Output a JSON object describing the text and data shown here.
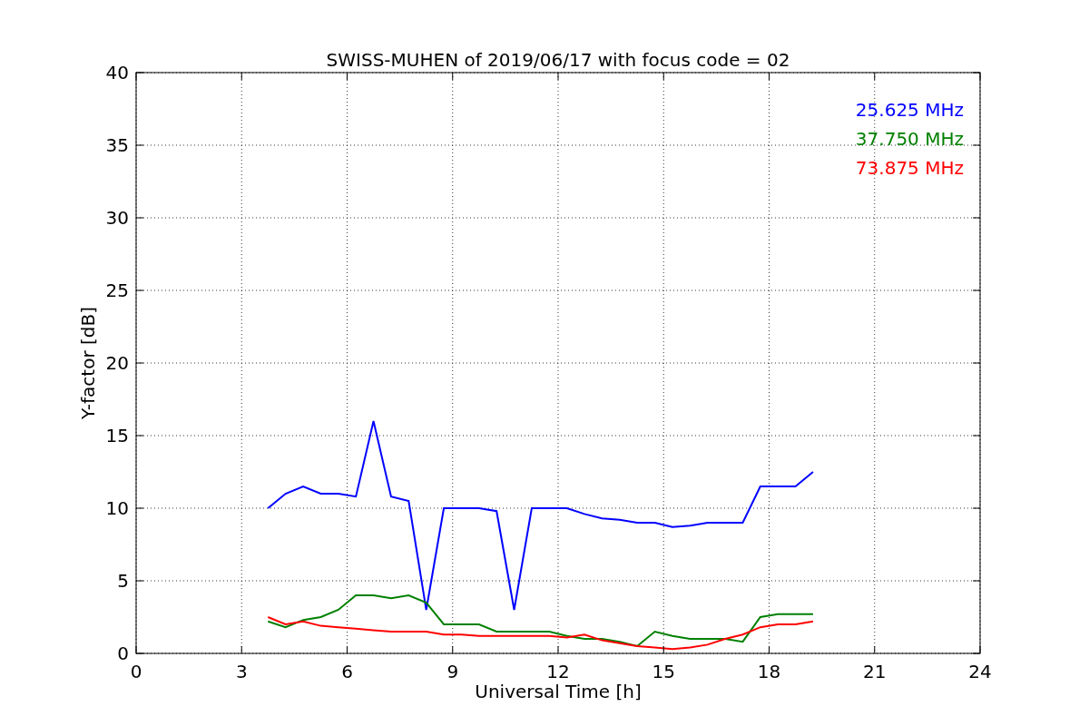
{
  "figure": {
    "chart_data": {
      "type": "line",
      "title": "SWISS-MUHEN of 2019/06/17 with focus code = 02",
      "xlabel": "Universal Time [h]",
      "ylabel": "Y-factor [dB]",
      "x": [
        3.75,
        4.25,
        4.75,
        5.25,
        5.75,
        6.25,
        6.75,
        7.25,
        7.75,
        8.25,
        8.75,
        9.25,
        9.75,
        10.25,
        10.75,
        11.25,
        11.75,
        12.25,
        12.75,
        13.25,
        13.75,
        14.25,
        14.75,
        15.25,
        15.75,
        16.25,
        16.75,
        17.25,
        17.75,
        18.25,
        18.75,
        19.25
      ],
      "series": [
        {
          "name": "25.625 MHz",
          "color": "#0000ff",
          "values": [
            10,
            11,
            11.5,
            11,
            11,
            10.8,
            16,
            10.8,
            10.5,
            3,
            10,
            10,
            10,
            9.8,
            3,
            10,
            10,
            10,
            9.6,
            9.3,
            9.2,
            9,
            9,
            8.7,
            8.8,
            9,
            9,
            9,
            11.5,
            11.5,
            11.5,
            12.5
          ]
        },
        {
          "name": "37.750 MHz",
          "color": "#008000",
          "values": [
            2.2,
            1.8,
            2.3,
            2.5,
            3,
            4,
            4,
            3.8,
            4,
            3.5,
            2,
            2,
            2,
            1.5,
            1.5,
            1.5,
            1.5,
            1.2,
            1,
            1,
            0.8,
            0.5,
            1.5,
            1.2,
            1,
            1,
            1,
            0.8,
            2.5,
            2.7,
            2.7,
            2.7
          ]
        },
        {
          "name": "73.875 MHz",
          "color": "#ff0000",
          "values": [
            2.5,
            2,
            2.2,
            1.9,
            1.8,
            1.7,
            1.6,
            1.5,
            1.5,
            1.5,
            1.3,
            1.3,
            1.2,
            1.2,
            1.2,
            1.2,
            1.2,
            1.1,
            1.3,
            0.9,
            0.7,
            0.5,
            0.4,
            0.3,
            0.4,
            0.6,
            1,
            1.3,
            1.8,
            2,
            2,
            2.2
          ]
        }
      ],
      "grid": true,
      "xlim": [
        0,
        24
      ],
      "ylim": [
        0,
        40
      ],
      "xticks": [
        0,
        3,
        6,
        9,
        12,
        15,
        18,
        21,
        24
      ],
      "yticks": [
        0,
        5,
        10,
        15,
        20,
        25,
        30,
        35,
        40
      ]
    }
  }
}
